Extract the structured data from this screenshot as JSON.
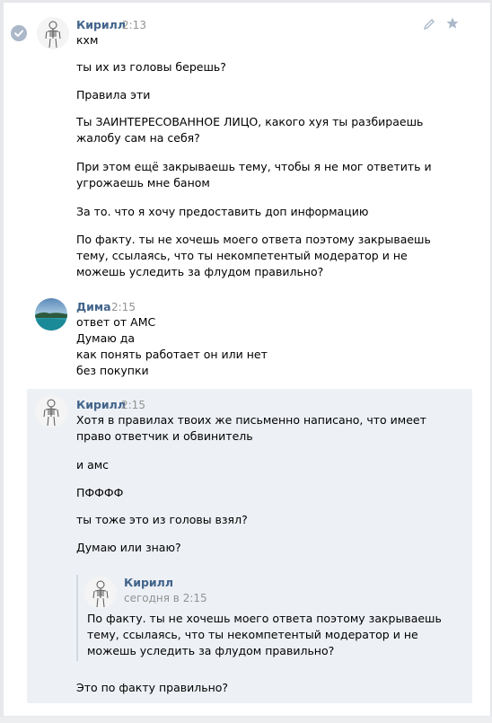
{
  "messages": [
    {
      "author": "Кирилл",
      "time": "2:13",
      "lines": [
        "кхм",
        "ты их из головы берешь?",
        "Правила эти",
        "Ты ЗАИНТЕРЕСОВАННОЕ ЛИЦО, какого хуя ты разбираешь",
        "жалобу сам на себя?",
        "При этом ещё закрываешь тему, чтобы я не мог ответить и",
        "угрожаешь мне баном",
        "За то. что я хочу предоставить доп информацию",
        "По факту. ты не хочешь моего ответа поэтому закрываешь",
        "тему, ссылаясь, что ты некомпетентый модератор и не",
        "можешь уследить за флудом правильно?"
      ]
    },
    {
      "author": "Дима",
      "time": "2:15",
      "lines": [
        "ответ от АМС",
        "Думаю да",
        "как понять работает он или нет",
        "без покупки"
      ]
    },
    {
      "author": "Кирилл",
      "time": "2:15",
      "lines": [
        "Хотя в правилах твоих же письменно написано, что имеет",
        "право ответчик и обвинитель",
        "и амс",
        "ПФФФФ",
        "ты тоже это из головы взял?",
        "Думаю или знаю?"
      ],
      "forwarded": {
        "author": "Кирилл",
        "time": "сегодня в 2:15",
        "lines": [
          "По факту. ты не хочешь моего ответа поэтому закрываешь",
          "тему, ссылаясь, что ты некомпетентый модератор и не",
          "можешь уследить за флудом правильно?"
        ]
      },
      "after_forward": "Это по факту правильно?"
    }
  ],
  "icons": {
    "selected": "check-icon",
    "edit": "pencil-icon",
    "favorite": "star-icon"
  },
  "colors": {
    "author": "#42648b",
    "time": "#939393",
    "selected_bg": "#edf0f5",
    "check": "#aab8c9"
  }
}
